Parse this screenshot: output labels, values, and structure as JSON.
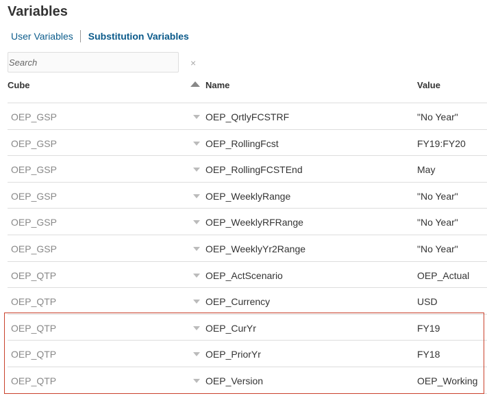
{
  "page": {
    "title": "Variables"
  },
  "tabs": [
    {
      "label": "User Variables",
      "active": false
    },
    {
      "label": "Substitution Variables",
      "active": true
    }
  ],
  "search": {
    "placeholder": "Search",
    "value": "",
    "clear_icon": "×"
  },
  "table": {
    "columns": {
      "cube": "Cube",
      "name": "Name",
      "value": "Value"
    },
    "sort": {
      "column": "Name",
      "direction": "ascending"
    },
    "rows": [
      {
        "cube": "OEP_GSP",
        "name": "OEP_QrtlyFCSTRF",
        "value": "\"No Year\""
      },
      {
        "cube": "OEP_GSP",
        "name": "OEP_RollingFcst",
        "value": "FY19:FY20"
      },
      {
        "cube": "OEP_GSP",
        "name": "OEP_RollingFCSTEnd",
        "value": "May"
      },
      {
        "cube": "OEP_GSP",
        "name": "OEP_WeeklyRange",
        "value": "\"No Year\""
      },
      {
        "cube": "OEP_GSP",
        "name": "OEP_WeeklyRFRange",
        "value": "\"No Year\""
      },
      {
        "cube": "OEP_GSP",
        "name": "OEP_WeeklyYr2Range",
        "value": "\"No Year\""
      },
      {
        "cube": "OEP_QTP",
        "name": "OEP_ActScenario",
        "value": "OEP_Actual"
      },
      {
        "cube": "OEP_QTP",
        "name": "OEP_Currency",
        "value": "USD"
      },
      {
        "cube": "OEP_QTP",
        "name": "OEP_CurYr",
        "value": "FY19"
      },
      {
        "cube": "OEP_QTP",
        "name": "OEP_PriorYr",
        "value": "FY18"
      },
      {
        "cube": "OEP_QTP",
        "name": "OEP_Version",
        "value": "OEP_Working"
      }
    ]
  },
  "colors": {
    "accent": "#0b5a8a",
    "highlight": "#c9402a"
  }
}
